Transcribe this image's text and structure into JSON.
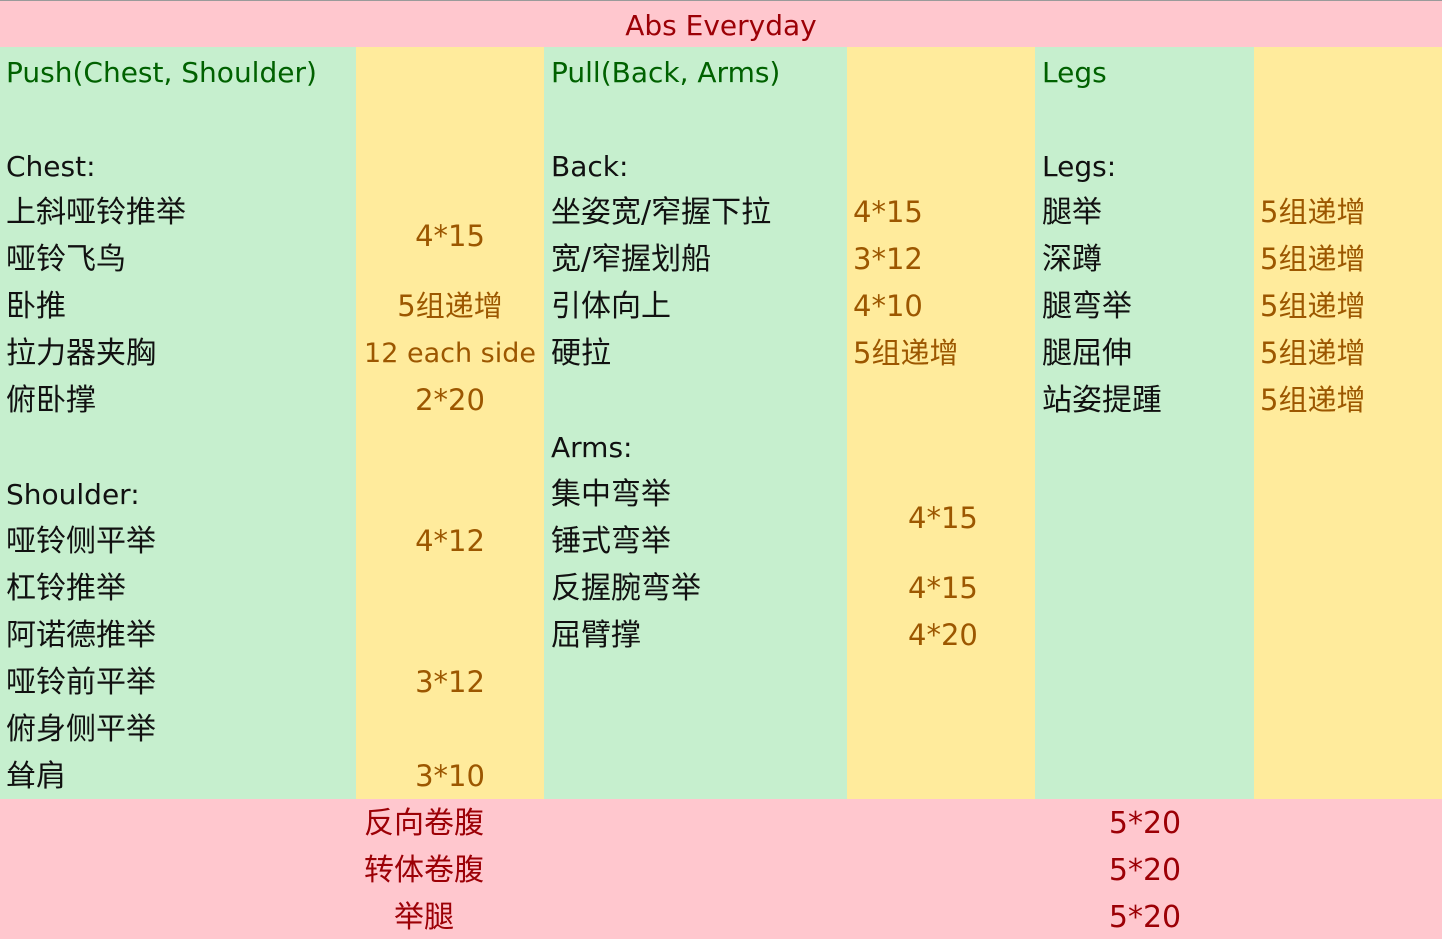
{
  "title": "Abs Everyday",
  "push": {
    "header": "Push(Chest, Shoulder)",
    "chest_heading": "Chest:",
    "chest": [
      {
        "name": "上斜哑铃推举"
      },
      {
        "name": "哑铃飞鸟"
      },
      {
        "name": "卧推"
      },
      {
        "name": "拉力器夹胸"
      },
      {
        "name": "俯卧撑"
      }
    ],
    "chest_values": [
      "4*15",
      "5组递增",
      "12 each side",
      "2*20"
    ],
    "shoulder_heading": "Shoulder:",
    "shoulder": [
      {
        "name": "哑铃侧平举"
      },
      {
        "name": "杠铃推举"
      },
      {
        "name": "阿诺德推举"
      },
      {
        "name": "哑铃前平举"
      },
      {
        "name": "俯身侧平举"
      },
      {
        "name": "耸肩"
      }
    ],
    "shoulder_values": [
      "4*12",
      "3*12",
      "3*10"
    ]
  },
  "pull": {
    "header": "Pull(Back, Arms)",
    "back_heading": "Back:",
    "back": [
      {
        "name": "坐姿宽/窄握下拉",
        "value": "4*15"
      },
      {
        "name": "宽/窄握划船",
        "value": "3*12"
      },
      {
        "name": "引体向上",
        "value": "4*10"
      },
      {
        "name": "硬拉",
        "value": "5组递增"
      }
    ],
    "arms_heading": "Arms:",
    "arms": [
      {
        "name": "集中弯举"
      },
      {
        "name": "锤式弯举"
      },
      {
        "name": "反握腕弯举"
      },
      {
        "name": "屈臂撑"
      }
    ],
    "arms_values": [
      "4*15",
      "4*15",
      "4*20"
    ]
  },
  "legs": {
    "header": "Legs",
    "heading": "Legs:",
    "items": [
      {
        "name": "腿举",
        "value": "5组递增"
      },
      {
        "name": "深蹲",
        "value": "5组递增"
      },
      {
        "name": "腿弯举",
        "value": "5组递增"
      },
      {
        "name": "腿屈伸",
        "value": "5组递增"
      },
      {
        "name": "站姿提踵",
        "value": "5组递增"
      }
    ]
  },
  "abs": [
    {
      "name": "反向卷腹",
      "value": "5*20"
    },
    {
      "name": "转体卷腹",
      "value": "5*20"
    },
    {
      "name": "举腿",
      "value": "5*20"
    }
  ],
  "colors": {
    "pink_fill": "#ffc7ce",
    "pink_text": "#9c0006",
    "green_fill": "#c6efce",
    "green_text": "#006100",
    "yellow_fill": "#ffeb9c",
    "yellow_text": "#9c5700"
  }
}
